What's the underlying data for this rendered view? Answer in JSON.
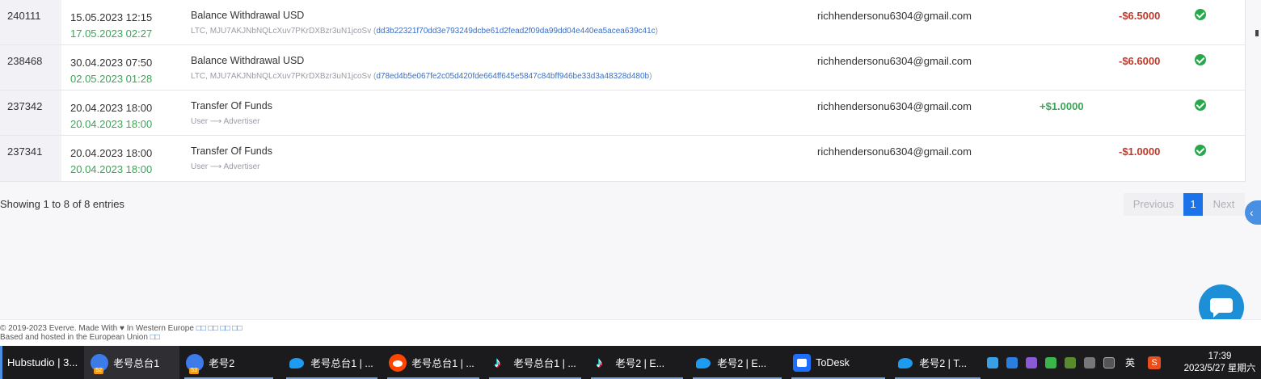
{
  "rows": [
    {
      "id": "240111",
      "date": "15.05.2023 12:15",
      "done": "17.05.2023 02:27",
      "title": "Balance Withdrawal USD",
      "sub_prefix": "LTC, MJU7AKJNbNQLcXuv7PKrDXBzr3uN1jcoSv (",
      "hash": "dd3b22321f70dd3e793249dcbe61d2fead2f09da99dd04e440ea5acea639c41c",
      "sub_suffix": ")",
      "email": "richhendersonu6304@gmail.com",
      "credit": "",
      "debit": "-$6.5000"
    },
    {
      "id": "238468",
      "date": "30.04.2023 07:50",
      "done": "02.05.2023 01:28",
      "title": "Balance Withdrawal USD",
      "sub_prefix": "LTC, MJU7AKJNbNQLcXuv7PKrDXBzr3uN1jcoSv (",
      "hash": "d78ed4b5e067fe2c05d420fde664ff645e5847c84bff946be33d3a48328d480b",
      "sub_suffix": ")",
      "email": "richhendersonu6304@gmail.com",
      "credit": "",
      "debit": "-$6.6000"
    },
    {
      "id": "237342",
      "date": "20.04.2023 18:00",
      "done": "20.04.2023 18:00",
      "title": "Transfer Of Funds",
      "sub_prefix": "User ⟶ Advertiser",
      "hash": "",
      "sub_suffix": "",
      "email": "richhendersonu6304@gmail.com",
      "credit": "+$1.0000",
      "debit": ""
    },
    {
      "id": "237341",
      "date": "20.04.2023 18:00",
      "done": "20.04.2023 18:00",
      "title": "Transfer Of Funds",
      "sub_prefix": "User ⟶ Advertiser",
      "hash": "",
      "sub_suffix": "",
      "email": "richhendersonu6304@gmail.com",
      "credit": "",
      "debit": "-$1.0000"
    }
  ],
  "showing": "Showing 1 to 8 of 8 entries",
  "pagination": {
    "previous": "Previous",
    "page": "1",
    "next": "Next"
  },
  "footer": {
    "line1": "© 2019-2023 Everve. Made With ♥ In Western Europe",
    "line1_links": "□□ □□ □□ □□",
    "line2": "Based and hosted in the European Union",
    "line2_links": "□□"
  },
  "taskbar": {
    "start": "Hubstudio | 3...",
    "tasks": [
      {
        "icon": "hubstudio-icon",
        "badge": "52",
        "label": "老号总台1",
        "active": true
      },
      {
        "icon": "hubstudio-icon",
        "badge": "53",
        "label": "老号2",
        "active": false
      },
      {
        "icon": "twitter-icon",
        "badge": "",
        "label": "老号总台1 | ...",
        "active": false
      },
      {
        "icon": "reddit-icon",
        "badge": "",
        "label": "老号总台1 | ...",
        "active": false
      },
      {
        "icon": "tiktok-icon",
        "badge": "",
        "label": "老号总台1 | ...",
        "active": false
      },
      {
        "icon": "tiktok-icon",
        "badge": "",
        "label": "老号2 | E...",
        "active": false
      },
      {
        "icon": "twitter-icon",
        "badge": "",
        "label": "老号2 | E...",
        "active": false
      },
      {
        "icon": "todesk-icon",
        "badge": "",
        "label": "ToDesk",
        "active": false
      },
      {
        "icon": "twitter-icon",
        "badge": "",
        "label": "老号2 | T...",
        "active": false
      }
    ],
    "lang": "英",
    "time": "17:39",
    "date": "2023/5/27 星期六"
  },
  "colors": {
    "credit": "#3aa655",
    "debit": "#c0392b",
    "link": "#3b6fc4",
    "accent": "#1a73e8"
  }
}
